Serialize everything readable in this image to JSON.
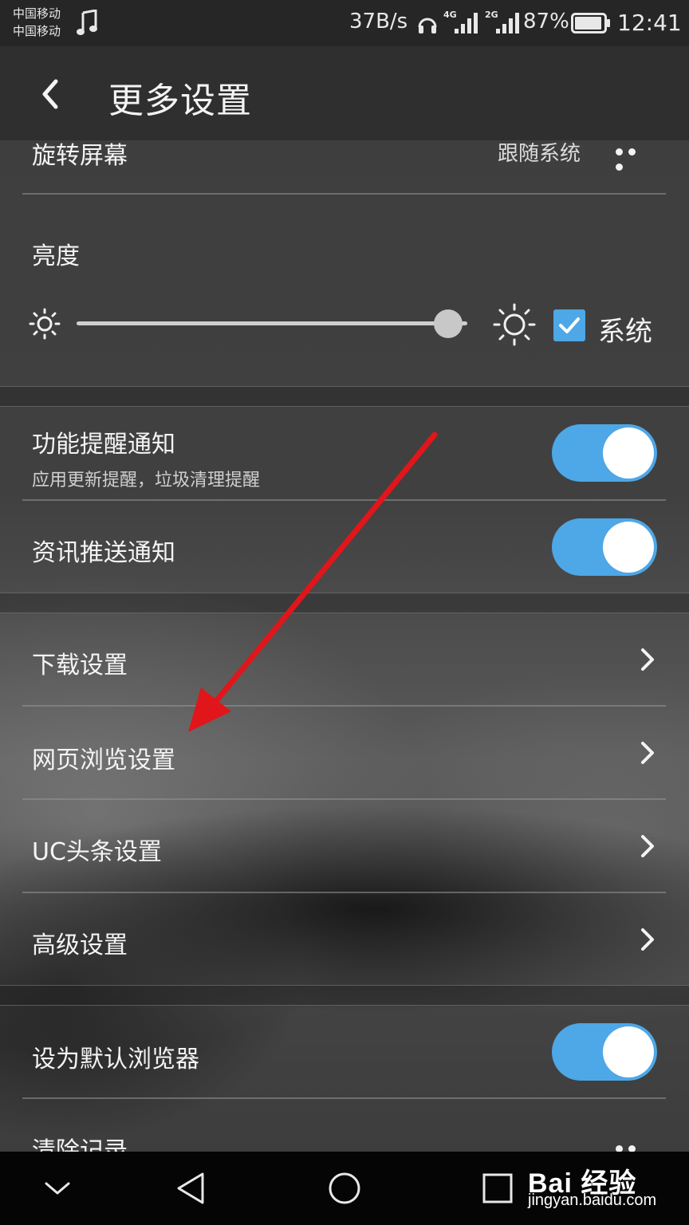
{
  "status_bar": {
    "carrier_1": "中国移动",
    "carrier_2": "中国移动",
    "speed": "37B/s",
    "network_1": "4G",
    "network_2": "2G",
    "battery": "87%",
    "time": "12:41"
  },
  "header": {
    "title": "更多设置"
  },
  "settings": {
    "rotate": {
      "label": "旋转屏幕",
      "value": "跟随系统"
    },
    "brightness": {
      "label": "亮度",
      "level": 0.95,
      "system_label": "系统",
      "system_checked": true
    },
    "feature_notify": {
      "label": "功能提醒通知",
      "sub": "应用更新提醒，垃圾清理提醒",
      "on": true
    },
    "news_notify": {
      "label": "资讯推送通知",
      "on": true
    },
    "download": {
      "label": "下载设置"
    },
    "browsing": {
      "label": "网页浏览设置"
    },
    "uc_headlines": {
      "label": "UC头条设置"
    },
    "advanced": {
      "label": "高级设置"
    },
    "default_browser": {
      "label": "设为默认浏览器",
      "on": true
    },
    "clear_records": {
      "label": "清除记录"
    }
  },
  "colors": {
    "accent": "#4ea7e6",
    "arrow": "#e0161b"
  },
  "watermark": {
    "logo_text": "Bai 经验",
    "url": "jingyan.baidu.com"
  }
}
